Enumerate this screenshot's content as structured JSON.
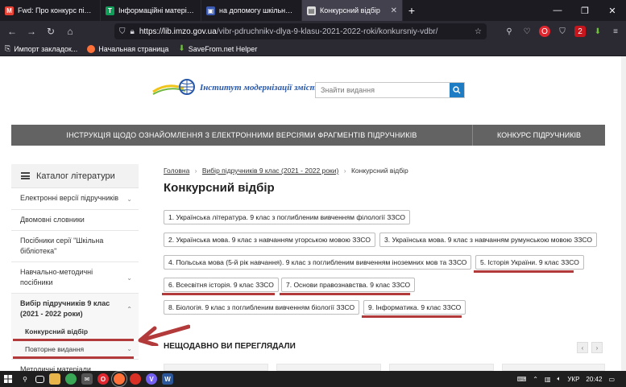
{
  "browser": {
    "tabs": [
      {
        "label": "Fwd: Про конкурс підручників",
        "favicon": "gmail-icon",
        "color": "#ea4335",
        "glyph": "M",
        "active": false
      },
      {
        "label": "Інформаційні матеріали та ма",
        "favicon": "sheets-icon",
        "color": "#0f9d58",
        "glyph": "T",
        "active": false
      },
      {
        "label": "на допомогу шкільним бібліо",
        "favicon": "site-icon",
        "color": "#3b5bb5",
        "glyph": "▣",
        "active": false
      },
      {
        "label": "Конкурсний відбір",
        "favicon": "page-icon",
        "color": "#dddddd",
        "glyph": "▤",
        "active": true
      }
    ],
    "new_tab": "+",
    "url_host": "https://lib.imzo.gov.ua",
    "url_path": "/vibr-pdruchnikv-dlya-9-klasu-2021-2022-roki/konkursniy-vdbr/",
    "bookmarks": [
      {
        "label": "Импорт закладок...",
        "color": "#cfcfd8"
      },
      {
        "label": "Начальная страница",
        "color": "#ff7139"
      },
      {
        "label": "SaveFrom.net Helper",
        "color": "#6fc13a"
      }
    ]
  },
  "header": {
    "logo_text": "Інститут модернізації змісту освіти",
    "search_placeholder": "Знайти видання"
  },
  "menubar": {
    "item1": "ІНСТРУКЦІЯ ЩОДО ОЗНАЙОМЛЕННЯ З ЕЛЕКТРОННИМИ ВЕРСІЯМИ ФРАГМЕНТІВ ПІДРУЧНИКІВ",
    "item2": "КОНКУРС ПІДРУЧНИКІВ"
  },
  "sidebar": {
    "title": "Каталог літератури",
    "items": [
      {
        "label": "Електронні версії підручників",
        "chev": "⌄"
      },
      {
        "label": "Двомовні словники",
        "chev": ""
      },
      {
        "label": "Посібники серії \"Шкільна бібліотека\"",
        "chev": ""
      },
      {
        "label": "Навчально-методичні посібники",
        "chev": "⌄"
      },
      {
        "label": "Вибір підручників 9 клас (2021 - 2022 роки)",
        "chev": "⌃"
      }
    ],
    "subitems": [
      {
        "label": "Конкурсний відбір",
        "chev": "",
        "bold": true
      },
      {
        "label": "Повторне видання",
        "chev": "⌄",
        "bold": false
      }
    ],
    "last_item": "Методичні матеріали"
  },
  "breadcrumb": {
    "home": "Головна",
    "parent": "Вибір підручників 9 клас (2021 - 2022 роки)",
    "current": "Конкурсний відбір",
    "sep": "›"
  },
  "main": {
    "title": "Конкурсний відбір",
    "chips": [
      "1. Українська література. 9 клас з поглибленим вивченням філології ЗЗСО",
      "2. Українська мова. 9 клас з навчанням угорською мовою ЗЗСО",
      "3. Українська мова. 9 клас з навчанням румунською мовою ЗЗСО",
      "4. Польська мова (5-й рік навчання). 9 клас з поглибленим вивченням іноземних мов та ЗЗСО",
      "5. Історія України. 9 клас ЗЗСО",
      "6. Всесвітня історія. 9 клас ЗЗСО",
      "7. Основи правознавства. 9 клас ЗЗСО",
      "8. Біологія. 9 клас з поглибленим вивченням біології ЗЗСО",
      "9. Інформатика. 9 клас ЗЗСО"
    ],
    "recent_title": "НЕЩОДАВНО ВИ ПЕРЕГЛЯДАЛИ",
    "prev": "‹",
    "next": "›"
  },
  "taskbar": {
    "lang": "УКР",
    "time": "20:42"
  },
  "colors": {
    "accent_red": "#b33a3a",
    "menubar": "#636363",
    "search_button": "#1e7cc4"
  }
}
